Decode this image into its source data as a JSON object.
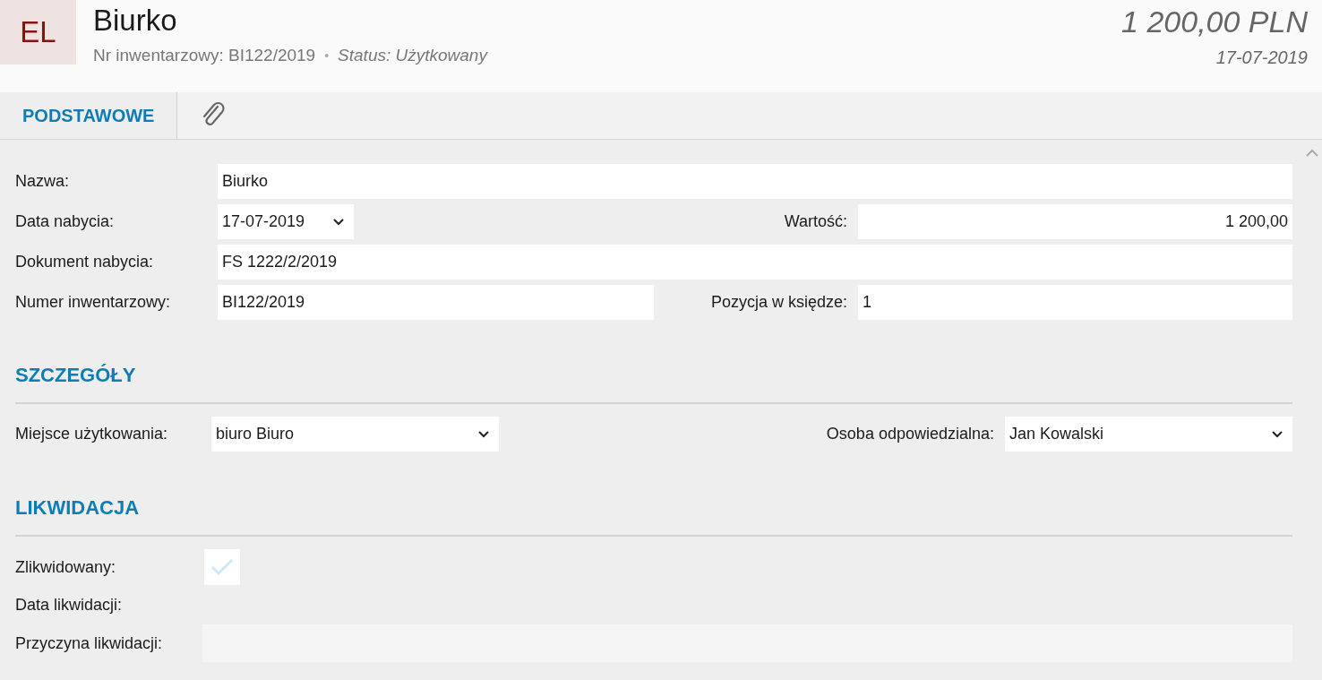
{
  "header": {
    "avatar": "EL",
    "title": "Biurko",
    "inventory": "Nr inwentarzowy: BI122/2019",
    "separator": "•",
    "status": "Status: Użytkowany",
    "amount": "1 200,00 PLN",
    "date": "17-07-2019"
  },
  "tabs": [
    {
      "kind": "text",
      "label": "PODSTAWOWE",
      "selected": true
    },
    {
      "kind": "attachment",
      "selected": false
    }
  ],
  "basic": {
    "name": {
      "label": "Nazwa:",
      "value": "Biurko"
    },
    "acquisition_date": {
      "label": "Data nabycia:",
      "value": "17-07-2019"
    },
    "value": {
      "label": "Wartość:",
      "value": "1 200,00"
    },
    "document": {
      "label": "Dokument nabycia:",
      "value": "FS 1222/2/2019"
    },
    "inventory_number": {
      "label": "Numer inwentarzowy:",
      "value": "BI122/2019"
    },
    "book_position": {
      "label": "Pozycja w księdze:",
      "value": "1"
    }
  },
  "details": {
    "heading": "SZCZEGÓŁY",
    "place": {
      "label": "Miejsce użytkowania:",
      "value": "biuro Biuro"
    },
    "person": {
      "label": "Osoba odpowiedzialna:",
      "value": "Jan Kowalski"
    }
  },
  "liquidation": {
    "heading": "LIKWIDACJA",
    "liquidated": {
      "label": "Zlikwidowany:",
      "checked": false
    },
    "date": {
      "label": "Data likwidacji:"
    },
    "reason": {
      "label": "Przyczyna likwidacji:",
      "disabled": true
    }
  }
}
